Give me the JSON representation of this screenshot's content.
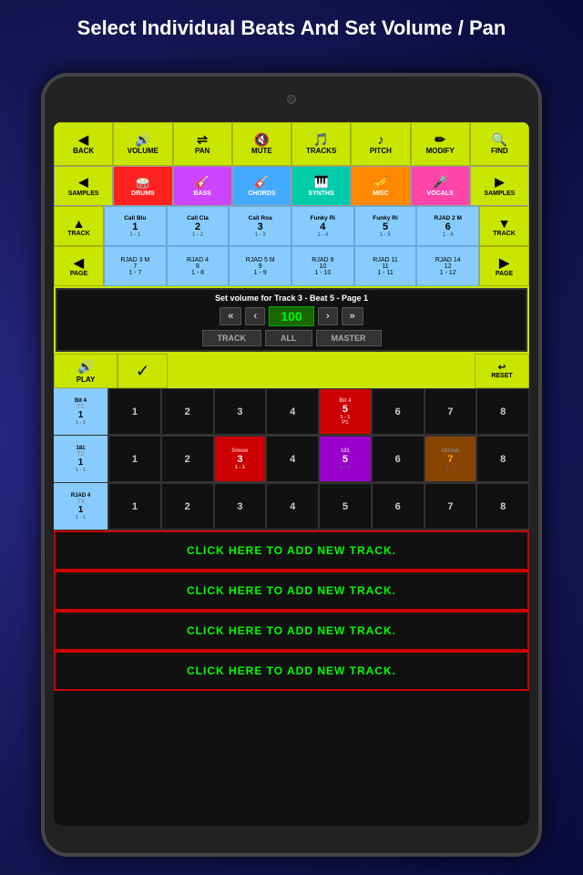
{
  "page": {
    "title": "Select Individual Beats And Set Volume / Pan"
  },
  "toolbar": {
    "buttons": [
      {
        "id": "back",
        "label": "BACK",
        "icon": "◀"
      },
      {
        "id": "volume",
        "label": "VOLUME",
        "icon": "🔊"
      },
      {
        "id": "pan",
        "label": "PAN",
        "icon": "🔄"
      },
      {
        "id": "mute",
        "label": "MUTE",
        "icon": "🔇"
      },
      {
        "id": "tracks",
        "label": "TRACKS",
        "icon": "≡"
      },
      {
        "id": "pitch",
        "label": "PITCH",
        "icon": "🎵"
      },
      {
        "id": "modify",
        "label": "MODIFY",
        "icon": "✏"
      },
      {
        "id": "find",
        "label": "FIND",
        "icon": "🔍"
      }
    ]
  },
  "categories": [
    {
      "id": "samples-l",
      "label": "SAMPLES",
      "icon": "◀",
      "class": "samples-l"
    },
    {
      "id": "drums",
      "label": "DRUMS",
      "icon": "🥁",
      "class": "drums"
    },
    {
      "id": "bass",
      "label": "BASS",
      "icon": "🎸",
      "class": "bass"
    },
    {
      "id": "chords",
      "label": "CHORDS",
      "icon": "🎸",
      "class": "chords"
    },
    {
      "id": "synths",
      "label": "SYNTHS",
      "icon": "🎹",
      "class": "synths"
    },
    {
      "id": "misc",
      "label": "MISC",
      "icon": "🎺",
      "class": "misc"
    },
    {
      "id": "vocals",
      "label": "VOCALS",
      "icon": "🎤",
      "class": "vocals"
    },
    {
      "id": "samples-r",
      "label": "SAMPLES",
      "icon": "▶",
      "class": "samples-r"
    }
  ],
  "track_row1": {
    "cells": [
      {
        "name": "Call Blu",
        "num": "1",
        "sub": "1 - 1"
      },
      {
        "name": "Call Cla",
        "num": "2",
        "sub": "1 - 2"
      },
      {
        "name": "Call Roa",
        "num": "3",
        "sub": "1 - 3"
      },
      {
        "name": "Funky Ri",
        "num": "4",
        "sub": "1 - 4"
      },
      {
        "name": "Funky Ri",
        "num": "5",
        "sub": "1 - 5"
      },
      {
        "name": "RJAD 2 M",
        "num": "6",
        "sub": "1 - 6"
      }
    ]
  },
  "track_row2": {
    "cells": [
      {
        "name": "RJAD 3 M",
        "num": "7",
        "sub": "1 - 7"
      },
      {
        "name": "RJAD 4",
        "num": "8",
        "sub": "1 - 8"
      },
      {
        "name": "RJAD 5 M",
        "num": "9",
        "sub": "1 - 9"
      },
      {
        "name": "RJAD 9",
        "num": "10",
        "sub": "1 - 10"
      },
      {
        "name": "RJAD 11",
        "num": "11",
        "sub": "1 - 11"
      },
      {
        "name": "RJAD 14",
        "num": "12",
        "sub": "1 - 12"
      }
    ]
  },
  "volume": {
    "title": "Set volume for Track 3 - Beat 5 - Page 1",
    "value": "100",
    "tabs": [
      "TRACK",
      "ALL",
      "MASTER"
    ]
  },
  "beat_rows": [
    {
      "id": "T1",
      "track_name": "Bit 4",
      "num": "1",
      "sub": "1 - 1",
      "cells": [
        {
          "num": "1",
          "active": false
        },
        {
          "num": "2",
          "active": false
        },
        {
          "num": "3",
          "active": false
        },
        {
          "num": "4",
          "active": false
        },
        {
          "num": "5",
          "active": true,
          "color": "red",
          "name": "Bit 4"
        },
        {
          "num": "6",
          "active": false
        },
        {
          "num": "7",
          "active": false
        },
        {
          "num": "8",
          "active": false
        }
      ]
    },
    {
      "id": "T2",
      "track_name": "181",
      "num": "1",
      "sub": "1 - 1",
      "cells": [
        {
          "num": "1",
          "active": false
        },
        {
          "num": "2",
          "active": false
        },
        {
          "num": "3",
          "active": true,
          "color": "red",
          "name": "Simon"
        },
        {
          "num": "4",
          "active": false
        },
        {
          "num": "5",
          "active": true,
          "color": "purple",
          "name": "181"
        },
        {
          "num": "6",
          "active": false
        },
        {
          "num": "7",
          "active": true,
          "color": "orange",
          "name": "zSirius"
        },
        {
          "num": "8",
          "active": false
        }
      ]
    },
    {
      "id": "T3",
      "track_name": "RJAD 4",
      "num": "1",
      "sub": "1 - 1",
      "cells": [
        {
          "num": "1",
          "active": false
        },
        {
          "num": "2",
          "active": false
        },
        {
          "num": "3",
          "active": false
        },
        {
          "num": "4",
          "active": false
        },
        {
          "num": "5",
          "active": false
        },
        {
          "num": "6",
          "active": false
        },
        {
          "num": "7",
          "active": false
        },
        {
          "num": "8",
          "active": false
        }
      ]
    }
  ],
  "add_track_buttons": [
    "CLICK HERE TO ADD NEW TRACK.",
    "CLICK HERE TO ADD NEW TRACK.",
    "CLICK HERE TO ADD NEW TRACK.",
    "CLICK HERE TO ADD NEW TRACK."
  ]
}
